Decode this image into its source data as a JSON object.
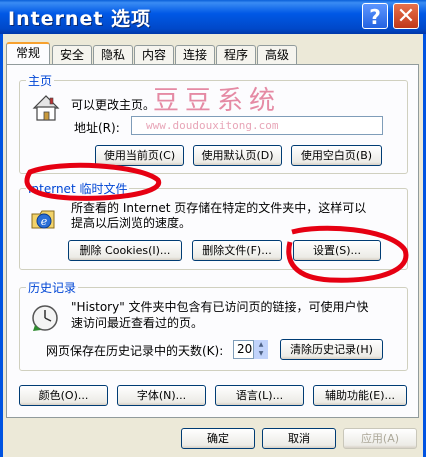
{
  "window": {
    "title": "Internet 选项"
  },
  "titlebar": {
    "help_glyph": "?",
    "close_glyph": "✕"
  },
  "tabs": [
    "常规",
    "安全",
    "隐私",
    "内容",
    "连接",
    "程序",
    "高级"
  ],
  "watermark": {
    "text": "豆豆系统",
    "url": "www.doudouxitong.com"
  },
  "homepage": {
    "title": "主页",
    "description": "可以更改主页。",
    "address_label": "地址(R):",
    "address_value": "",
    "buttons": [
      "使用当前页(C)",
      "使用默认页(D)",
      "使用空白页(B)"
    ]
  },
  "temp_files": {
    "title": "Internet 临时文件",
    "description_line1": "所查看的 Internet 页存储在特定的文件夹中，这样可以",
    "description_line2": "提高以后浏览的速度。",
    "buttons": [
      "删除 Cookies(I)...",
      "删除文件(F)...",
      "设置(S)..."
    ]
  },
  "history": {
    "title": "历史记录",
    "description_line1": "\"History\" 文件夹中包含有已访问页的链接，可使用户快",
    "description_line2": "速访问最近查看过的页。",
    "days_label": "网页保存在历史记录中的天数(K):",
    "days_value": "20",
    "clear_button": "清除历史记录(H)"
  },
  "bottom_buttons": [
    "颜色(O)...",
    "字体(N)...",
    "语言(L)...",
    "辅助功能(E)..."
  ],
  "dialog_buttons": {
    "ok": "确定",
    "cancel": "取消",
    "apply": "应用(A)"
  },
  "colors": {
    "titlebar": "#0058e6",
    "tab_active_accent": "#f7a12f",
    "annotation_red": "#e60012",
    "group_title": "#0046d5"
  }
}
